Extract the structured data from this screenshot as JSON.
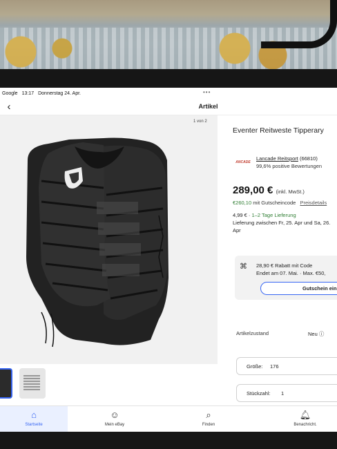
{
  "status_bar": {
    "app": "Google",
    "time": "13:17",
    "date": "Donnerstag 24. Apr."
  },
  "header": {
    "title": "Artikel"
  },
  "gallery": {
    "counter": "1 von 2"
  },
  "product": {
    "title": "Eventer Reitweste Tipperary",
    "seller_logo": "ANCADE",
    "seller_name": "Lancade Reitsport",
    "seller_score": "(66810)",
    "seller_rating": "99,6% positive Bewertungen",
    "price": "289,00 €",
    "price_tax": "(inkl. MwSt.)",
    "coupon_price": "€260,10",
    "coupon_price_suffix": "mit Gutscheincode",
    "coupon_details": "Preisdetails",
    "shipping_cost": "4,99 € ·",
    "shipping_speed": "1–2 Tage Lieferung",
    "delivery_window": "Lieferung zwischen Fr, 25. Apr und Sa, 26.",
    "delivery_window_end": "Apr"
  },
  "promo": {
    "line1": "28,90 € Rabatt mit Code",
    "line2": "Endet am 07. Mai. · Max. €50,",
    "button": "Gutschein einlösen"
  },
  "specs": {
    "condition_label": "Artikelzustand",
    "condition_value": "Neu",
    "size_label": "Größe:",
    "size_value": "176",
    "qty_label": "Stückzahl:",
    "qty_value": "1"
  },
  "nav": {
    "home": "Startseite",
    "my_ebay": "Mein eBay",
    "find": "Finden",
    "notifications": "Benachricht."
  },
  "colors": {
    "accent": "#3665f3",
    "green": "#2e7d32"
  }
}
